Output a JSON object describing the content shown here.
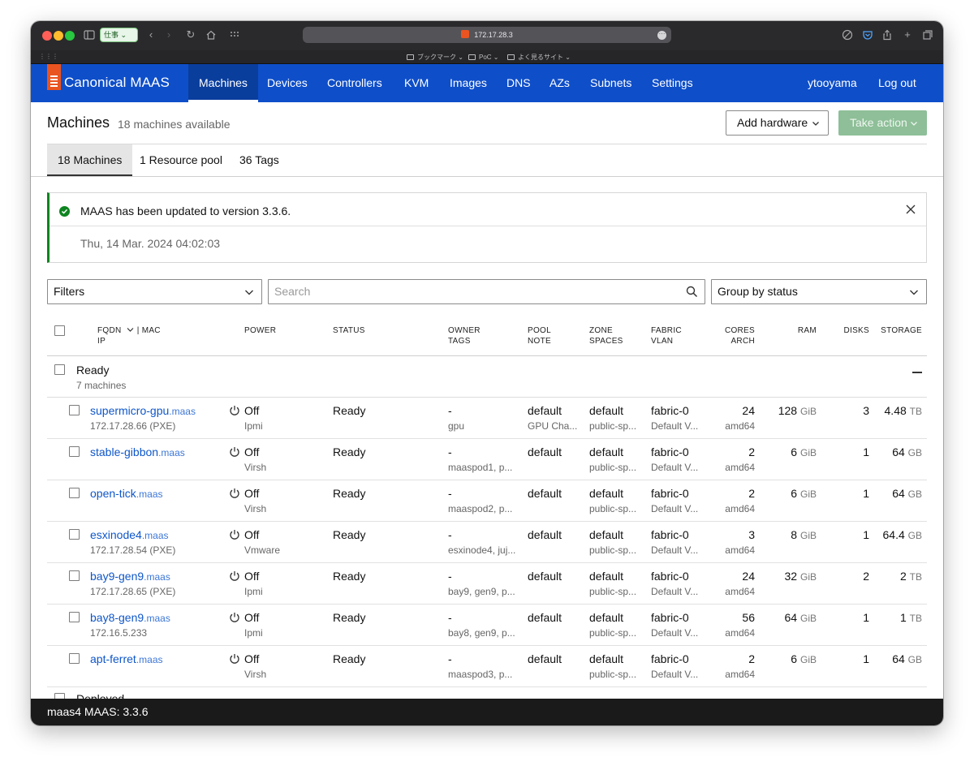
{
  "browser": {
    "profile_label": "仕事",
    "url": "172.17.28.3",
    "bookmarks": [
      "ブックマーク",
      "PoC",
      "よく見るサイト"
    ]
  },
  "nav": {
    "brand": "Canonical MAAS",
    "items": [
      "Machines",
      "Devices",
      "Controllers",
      "KVM",
      "Images",
      "DNS",
      "AZs",
      "Subnets",
      "Settings"
    ],
    "active": "Machines",
    "user": "ytooyama",
    "logout": "Log out"
  },
  "header": {
    "title": "Machines",
    "subtitle": "18 machines available",
    "add_hardware": "Add hardware",
    "take_action": "Take action"
  },
  "tabs": [
    {
      "label": "18 Machines",
      "active": true
    },
    {
      "label": "1 Resource pool",
      "active": false
    },
    {
      "label": "36 Tags",
      "active": false
    }
  ],
  "notification": {
    "message": "MAAS has been updated to version 3.3.6.",
    "date": "Thu, 14 Mar. 2024 04:02:03"
  },
  "controls": {
    "filters": "Filters",
    "search_placeholder": "Search",
    "group_by": "Group by status"
  },
  "columns": {
    "fqdn": "FQDN",
    "mac": "| MAC",
    "ip": "IP",
    "power": "POWER",
    "status": "STATUS",
    "owner": "OWNER",
    "tags": "TAGS",
    "pool": "POOL",
    "note": "NOTE",
    "zone": "ZONE",
    "spaces": "SPACES",
    "fabric": "FABRIC",
    "vlan": "VLAN",
    "cores": "CORES",
    "arch": "ARCH",
    "ram": "RAM",
    "disks": "DISKS",
    "storage": "STORAGE"
  },
  "groups": [
    {
      "name": "Ready",
      "count": "7 machines"
    },
    {
      "name": "Deployed"
    }
  ],
  "machines": [
    {
      "host": "supermicro-gpu",
      "domain": ".maas",
      "ip": "172.17.28.66 (PXE)",
      "power": "Off",
      "power_type": "Ipmi",
      "status": "Ready",
      "owner": "-",
      "tags": "gpu",
      "pool": "default",
      "note": "GPU Cha...",
      "zone": "default",
      "spaces": "public-sp...",
      "fabric": "fabric-0",
      "vlan": "Default V...",
      "cores": "24",
      "arch": "amd64",
      "ram": "128",
      "ram_unit": "GiB",
      "disks": "3",
      "storage": "4.48",
      "storage_unit": "TB"
    },
    {
      "host": "stable-gibbon",
      "domain": ".maas",
      "ip": "",
      "power": "Off",
      "power_type": "Virsh",
      "status": "Ready",
      "owner": "-",
      "tags": "maaspod1, p...",
      "pool": "default",
      "note": "",
      "zone": "default",
      "spaces": "public-sp...",
      "fabric": "fabric-0",
      "vlan": "Default V...",
      "cores": "2",
      "arch": "amd64",
      "ram": "6",
      "ram_unit": "GiB",
      "disks": "1",
      "storage": "64",
      "storage_unit": "GB"
    },
    {
      "host": "open-tick",
      "domain": ".maas",
      "ip": "",
      "power": "Off",
      "power_type": "Virsh",
      "status": "Ready",
      "owner": "-",
      "tags": "maaspod2, p...",
      "pool": "default",
      "note": "",
      "zone": "default",
      "spaces": "public-sp...",
      "fabric": "fabric-0",
      "vlan": "Default V...",
      "cores": "2",
      "arch": "amd64",
      "ram": "6",
      "ram_unit": "GiB",
      "disks": "1",
      "storage": "64",
      "storage_unit": "GB"
    },
    {
      "host": "esxinode4",
      "domain": ".maas",
      "ip": "172.17.28.54 (PXE)",
      "power": "Off",
      "power_type": "Vmware",
      "status": "Ready",
      "owner": "-",
      "tags": "esxinode4, juj...",
      "pool": "default",
      "note": "",
      "zone": "default",
      "spaces": "public-sp...",
      "fabric": "fabric-0",
      "vlan": "Default V...",
      "cores": "3",
      "arch": "amd64",
      "ram": "8",
      "ram_unit": "GiB",
      "disks": "1",
      "storage": "64.4",
      "storage_unit": "GB"
    },
    {
      "host": "bay9-gen9",
      "domain": ".maas",
      "ip": "172.17.28.65 (PXE)",
      "power": "Off",
      "power_type": "Ipmi",
      "status": "Ready",
      "owner": "-",
      "tags": "bay9, gen9, p...",
      "pool": "default",
      "note": "",
      "zone": "default",
      "spaces": "public-sp...",
      "fabric": "fabric-0",
      "vlan": "Default V...",
      "cores": "24",
      "arch": "amd64",
      "ram": "32",
      "ram_unit": "GiB",
      "disks": "2",
      "storage": "2",
      "storage_unit": "TB"
    },
    {
      "host": "bay8-gen9",
      "domain": ".maas",
      "ip": "172.16.5.233",
      "power": "Off",
      "power_type": "Ipmi",
      "status": "Ready",
      "owner": "-",
      "tags": "bay8, gen9, p...",
      "pool": "default",
      "note": "",
      "zone": "default",
      "spaces": "public-sp...",
      "fabric": "fabric-0",
      "vlan": "Default V...",
      "cores": "56",
      "arch": "amd64",
      "ram": "64",
      "ram_unit": "GiB",
      "disks": "1",
      "storage": "1",
      "storage_unit": "TB"
    },
    {
      "host": "apt-ferret",
      "domain": ".maas",
      "ip": "",
      "power": "Off",
      "power_type": "Virsh",
      "status": "Ready",
      "owner": "-",
      "tags": "maaspod3, p...",
      "pool": "default",
      "note": "",
      "zone": "default",
      "spaces": "public-sp...",
      "fabric": "fabric-0",
      "vlan": "Default V...",
      "cores": "2",
      "arch": "amd64",
      "ram": "6",
      "ram_unit": "GiB",
      "disks": "1",
      "storage": "64",
      "storage_unit": "GB"
    }
  ],
  "footer": {
    "text": "maas4 MAAS: 3.3.6"
  },
  "colors": {
    "nav_bg": "#0e4ec9",
    "brand_orange": "#e95420",
    "link": "#0e56c9",
    "success": "#0e8420",
    "take_action_disabled": "#8ebf98"
  }
}
